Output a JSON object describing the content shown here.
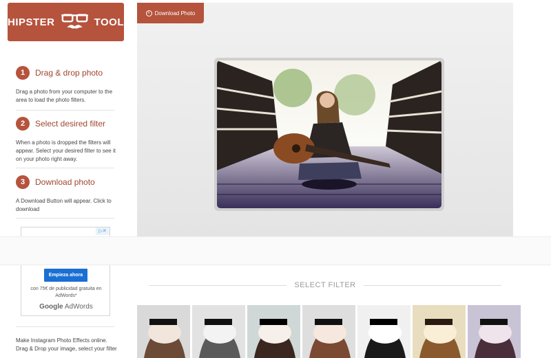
{
  "logo": {
    "left_text": "HIPSTER",
    "right_text": "TOOL"
  },
  "steps": [
    {
      "num": "1",
      "title": "Drag & drop photo",
      "text": "Drag a photo from your computer to the area to load the photo filters."
    },
    {
      "num": "2",
      "title": "Select desired filter",
      "text": "When a photo is dropped the filters will appear. Select your desired filter to see it on your photo right away."
    },
    {
      "num": "3",
      "title": "Download photo",
      "text": "A Download Button will appear. Click to download"
    }
  ],
  "ad": {
    "choices": "▷✕",
    "button": "Empieza ahora",
    "text": "con 75€ de publicidad gratuita en AdWords*",
    "logo_google": "Google",
    "logo_adwords": "AdWords"
  },
  "footer": {
    "text": "Make Instagram Photo Effects online. Drag & Drop your image, select your filter"
  },
  "download_button": {
    "label": "Download Photo",
    "icon": "download-circle-icon"
  },
  "filters": {
    "heading": "SELECT FILTER",
    "count": 7
  },
  "colors": {
    "accent": "#b5533d",
    "stage": "#e9e9e9"
  }
}
